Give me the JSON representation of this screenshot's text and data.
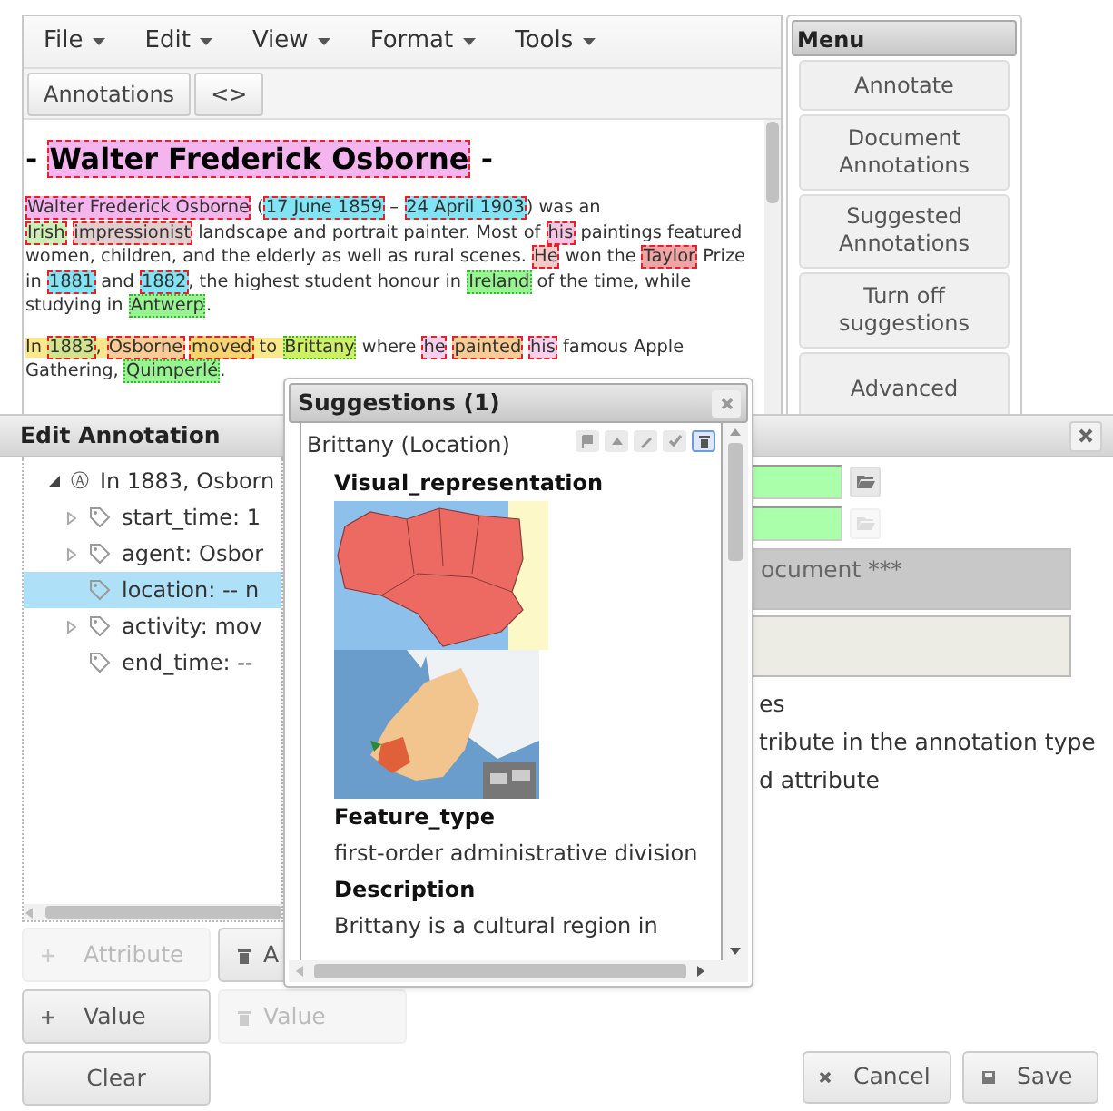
{
  "editor": {
    "menus": [
      "File",
      "Edit",
      "View",
      "Format",
      "Tools"
    ],
    "toolbar": [
      "Annotations",
      "<>"
    ],
    "heading": [
      {
        "kind": "plain",
        "text": "- "
      },
      {
        "kind": "annotation",
        "text": "Walter Frederick Osborne",
        "color": "#f4b4ee"
      },
      {
        "kind": "plain",
        "text": " -"
      }
    ],
    "paragraphs": [
      {
        "segments": [
          {
            "kind": "annotation",
            "text": "Walter Frederick Osborne",
            "color": "#f4b4ee"
          },
          {
            "kind": "plain",
            "text": " ("
          },
          {
            "kind": "annotation",
            "text": "17 June 1859",
            "color": "#80e4f4"
          },
          {
            "kind": "plain",
            "text": " – "
          },
          {
            "kind": "annotation",
            "text": "24 April 1903",
            "color": "#80e4f4"
          },
          {
            "kind": "plain",
            "text": ") was an "
          },
          {
            "kind": "annotation",
            "text": "Irish",
            "color": "#cdeeb4",
            "space_after": true
          },
          {
            "kind": "annotation",
            "text": "impressionist",
            "color": "#e2cccc"
          },
          {
            "kind": "plain",
            "text": " landscape and portrait painter. Most of "
          },
          {
            "kind": "annotation",
            "text": "his",
            "color": "#f8c4e4"
          },
          {
            "kind": "plain",
            "text": " paintings featured women, children, and the elderly as well as rural scenes. "
          },
          {
            "kind": "annotation",
            "text": "He",
            "color": "#f8c8c8"
          },
          {
            "kind": "plain",
            "text": " won the "
          },
          {
            "kind": "annotation",
            "text": "Taylor",
            "color": "#f0a4a4"
          },
          {
            "kind": "plain",
            "text": " Prize in "
          },
          {
            "kind": "annotation",
            "text": "1881",
            "color": "#80e4f4"
          },
          {
            "kind": "plain",
            "text": " and "
          },
          {
            "kind": "annotation",
            "text": "1882",
            "color": "#80e4f4"
          },
          {
            "kind": "plain",
            "text": ", the highest student honour in "
          },
          {
            "kind": "suggestion",
            "text": "Ireland",
            "color": "#98f490"
          },
          {
            "kind": "plain",
            "text": " of the time, while studying in "
          },
          {
            "kind": "suggestion",
            "text": "Antwerp",
            "color": "#98f490"
          },
          {
            "kind": "plain",
            "text": "."
          }
        ]
      },
      {
        "segments": [
          {
            "kind": "highlight",
            "text": "In ",
            "color": "#fbe88c"
          },
          {
            "kind": "annotation",
            "text": "1883",
            "color": "#d4e48c"
          },
          {
            "kind": "highlight",
            "text": ", ",
            "color": "#fbe88c"
          },
          {
            "kind": "annotation",
            "text": "Osborne",
            "color": "#f8cc94",
            "space_after": true
          },
          {
            "kind": "annotation",
            "text": "moved",
            "color": "#f8d470"
          },
          {
            "kind": "highlight",
            "text": " to ",
            "color": "#fbe88c"
          },
          {
            "kind": "suggestion",
            "text": "Brittany",
            "color": "#cdf064"
          },
          {
            "kind": "plain",
            "text": " where "
          },
          {
            "kind": "annotation",
            "text": "he",
            "color": "#f8d0ec",
            "space_after": true
          },
          {
            "kind": "annotation",
            "text": "painted",
            "color": "#f8cc94",
            "space_after": true
          },
          {
            "kind": "annotation",
            "text": "his",
            "color": "#f8d0ec"
          },
          {
            "kind": "plain",
            "text": " famous Apple Gathering, "
          },
          {
            "kind": "suggestion",
            "text": "Quimperlé",
            "color": "#98f490"
          },
          {
            "kind": "plain",
            "text": "."
          }
        ]
      }
    ]
  },
  "menu_panel": {
    "title": "Menu",
    "buttons": [
      "Annotate",
      "Document Annotations",
      "Suggested Annotations",
      "Turn off suggestions",
      "Advanced"
    ]
  },
  "edit_dialog": {
    "title": "Edit Annotation",
    "tree": {
      "icon": "Ⓐ",
      "label": "In 1883, Osborn",
      "expanded": true,
      "children": [
        {
          "label": "start_time: 1",
          "expandable": true,
          "selected": false
        },
        {
          "label": "agent: Osbor",
          "expandable": true,
          "selected": false
        },
        {
          "label": "location: -- n",
          "expandable": false,
          "selected": true
        },
        {
          "label": "activity: mov",
          "expandable": true,
          "selected": false
        },
        {
          "label": "end_time: --",
          "expandable": false,
          "selected": false
        }
      ]
    },
    "fields": [
      {
        "kind": "picker",
        "button_disabled": false
      },
      {
        "kind": "picker",
        "button_disabled": true
      },
      {
        "kind": "note",
        "value": "ocument ***",
        "disabled": true
      },
      {
        "kind": "note",
        "disabled": false
      }
    ],
    "options": [
      "es",
      "tribute in the annotation type",
      "d attribute"
    ],
    "buttons": [
      {
        "kind": "add",
        "label": "Attribute",
        "disabled": true
      },
      {
        "kind": "delete",
        "label": "A",
        "disabled": false
      },
      {
        "kind": "add",
        "label": "Value",
        "disabled": false
      },
      {
        "kind": "delete",
        "label": "Value",
        "disabled": true
      },
      {
        "kind": "plain",
        "label": "Clear",
        "disabled": false
      }
    ],
    "footer_buttons": [
      {
        "kind": "cancel",
        "label": "Cancel"
      },
      {
        "kind": "save",
        "label": "Save"
      }
    ]
  },
  "suggestions": {
    "title": "Suggestions (1)",
    "item": "Brittany (Location)",
    "actions": [
      {
        "kind": "flag",
        "selected": false
      },
      {
        "kind": "up",
        "selected": false
      },
      {
        "kind": "edit",
        "selected": false
      },
      {
        "kind": "accept",
        "selected": false
      },
      {
        "kind": "delete",
        "selected": true
      }
    ],
    "sections": [
      {
        "heading": "Visual_representation",
        "kind": "pictures"
      },
      {
        "heading": "Feature_type",
        "kind": "text",
        "text": "first-order administrative division"
      },
      {
        "heading": "Description",
        "kind": "text",
        "text": "Brittany is a cultural region in"
      }
    ]
  }
}
